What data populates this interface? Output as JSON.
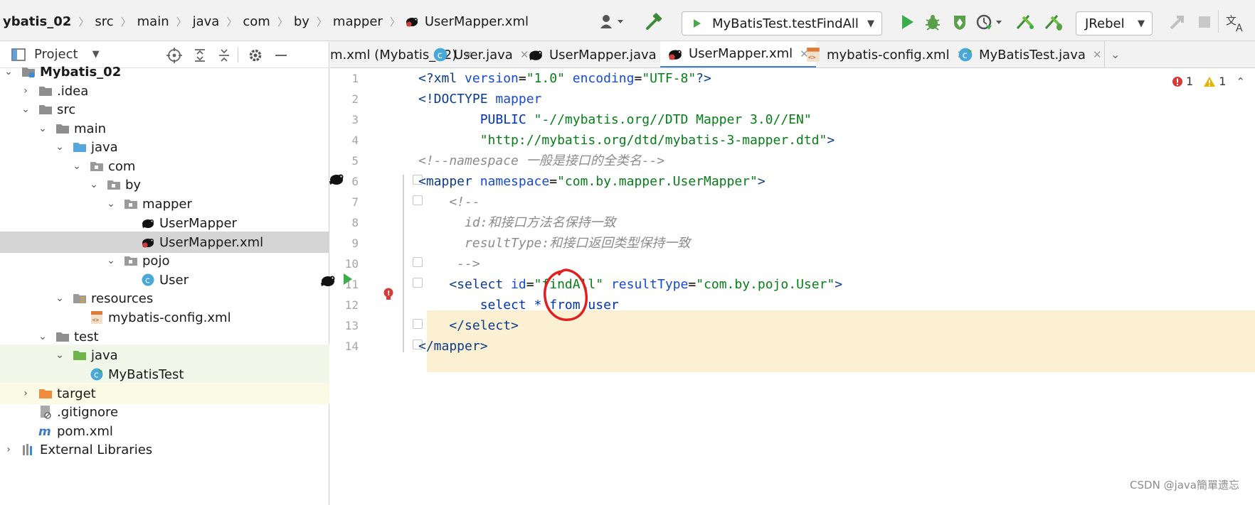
{
  "breadcrumb": {
    "items": [
      "ybatis_02",
      "src",
      "main",
      "java",
      "com",
      "by",
      "mapper",
      "UserMapper.xml"
    ]
  },
  "toolbar": {
    "run_config": "MyBatisTest.testFindAll",
    "jrebel_label": "JRebel"
  },
  "project_panel": {
    "title": "Project",
    "tree": [
      {
        "label": "Mybatis_02",
        "icon": "module-folder-icon",
        "expanded": true
      },
      {
        "label": ".idea",
        "icon": "folder-icon",
        "expanded": false
      },
      {
        "label": "src",
        "icon": "folder-icon",
        "expanded": true
      },
      {
        "label": "main",
        "icon": "folder-icon",
        "expanded": true
      },
      {
        "label": "java",
        "icon": "source-folder-icon",
        "expanded": true
      },
      {
        "label": "com",
        "icon": "package-icon",
        "expanded": true
      },
      {
        "label": "by",
        "icon": "package-icon",
        "expanded": true
      },
      {
        "label": "mapper",
        "icon": "package-icon",
        "expanded": true
      },
      {
        "label": "UserMapper",
        "icon": "mybatis-bird-icon"
      },
      {
        "label": "UserMapper.xml",
        "icon": "mybatis-xml-icon",
        "selected": true
      },
      {
        "label": "pojo",
        "icon": "package-icon",
        "expanded": true
      },
      {
        "label": "User",
        "icon": "class-icon"
      },
      {
        "label": "resources",
        "icon": "resources-folder-icon",
        "expanded": true
      },
      {
        "label": "mybatis-config.xml",
        "icon": "xml-file-icon"
      },
      {
        "label": "test",
        "icon": "folder-icon",
        "expanded": true
      },
      {
        "label": "java",
        "icon": "test-source-folder-icon",
        "expanded": true
      },
      {
        "label": "MyBatisTest",
        "icon": "test-class-icon"
      },
      {
        "label": "target",
        "icon": "excluded-folder-icon",
        "expanded": false
      },
      {
        "label": ".gitignore",
        "icon": "gitignore-file-icon"
      },
      {
        "label": "pom.xml",
        "icon": "maven-icon"
      },
      {
        "label": "External Libraries",
        "icon": "library-icon"
      }
    ]
  },
  "editor": {
    "tabs": [
      {
        "label": "m.xml (Mybatis_02)",
        "icon": ""
      },
      {
        "label": "User.java",
        "icon": "class-icon"
      },
      {
        "label": "UserMapper.java",
        "icon": "mybatis-bird-icon"
      },
      {
        "label": "UserMapper.xml",
        "icon": "mybatis-xml-icon",
        "active": true
      },
      {
        "label": "mybatis-config.xml",
        "icon": "xml-file-icon"
      },
      {
        "label": "MyBatisTest.java",
        "icon": "test-class-icon"
      }
    ],
    "line_numbers": [
      "1",
      "2",
      "3",
      "4",
      "5",
      "6",
      "7",
      "8",
      "9",
      "10",
      "11",
      "12",
      "13",
      "14"
    ],
    "code": {
      "l1_a": "<?xml ",
      "l1_b": "version",
      "l1_c": "=",
      "l1_d": "\"1.0\"",
      "l1_e": " encoding",
      "l1_f": "=",
      "l1_g": "\"UTF-8\"",
      "l1_h": "?>",
      "l2_a": "<!DOCTYPE ",
      "l2_b": "mapper",
      "l3_a": "        PUBLIC ",
      "l3_b": "\"-//mybatis.org//DTD Mapper 3.0//EN\"",
      "l4_a": "        \"http://mybatis.org/dtd/mybatis-3-mapper.dtd\"",
      "l4_b": ">",
      "l5": "<!--namespace 一般是接口的全类名-->",
      "l6_a": "<mapper ",
      "l6_b": "namespace",
      "l6_c": "=",
      "l6_d": "\"com.by.mapper.UserMapper\"",
      "l6_e": ">",
      "l7": "    <!--",
      "l8": "      id:和接口方法名保持一致",
      "l9": "      resultType:和接口返回类型保持一致",
      "l10": "     -->",
      "l11_a": "    <select ",
      "l11_b": "id",
      "l11_c": "=",
      "l11_d": "\"findAll\"",
      "l11_e": " resultType",
      "l11_f": "=",
      "l11_g": "\"com.by.pojo.User\"",
      "l11_h": ">",
      "l12": "        select * from user",
      "l13": "    </select>",
      "l14": "</mapper>"
    },
    "inspection": {
      "errors": "1",
      "warnings": "1"
    }
  },
  "watermark": "CSDN @java簡單遗忘",
  "colors": {
    "tab_active_underline": "#4083c9",
    "selected_row": "#d5d5d5",
    "error_red": "#d63a3a",
    "warning_yellow": "#e8b400",
    "run_green": "#3cae49",
    "highlight_row": "#fbf0d2"
  }
}
